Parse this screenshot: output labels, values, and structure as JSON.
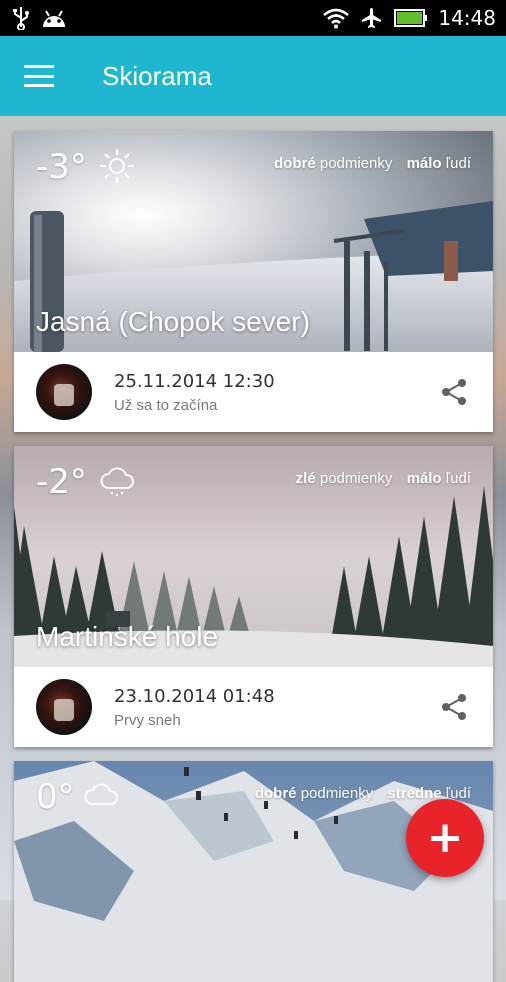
{
  "status_bar": {
    "time": "14:48",
    "icons": [
      "usb-icon",
      "android-icon",
      "wifi-icon",
      "airplane-icon",
      "battery-icon"
    ]
  },
  "app_bar": {
    "title": "Skiorama",
    "menu_icon": "menu-icon"
  },
  "cards": [
    {
      "temperature": "-3°",
      "weather_icon": "sun-icon",
      "condition_quality": "dobré",
      "condition_label": "podmienky",
      "crowd_level": "málo",
      "crowd_label": "ľudí",
      "place": "Jasná (Chopok sever)",
      "date": "25.11.2014 12:30",
      "caption": "Už sa to začína"
    },
    {
      "temperature": "-2°",
      "weather_icon": "snow-cloud-icon",
      "condition_quality": "zlé",
      "condition_label": "podmienky",
      "crowd_level": "málo",
      "crowd_label": "ľudí",
      "place": "Martinské hole",
      "date": "23.10.2014 01:48",
      "caption": "Prvy sneh"
    },
    {
      "temperature": "0°",
      "weather_icon": "cloud-icon",
      "condition_quality": "dobré",
      "condition_label": "podmienky",
      "crowd_level": "stredne",
      "crowd_label": "ľudí"
    }
  ],
  "fab": {
    "label": "+"
  },
  "colors": {
    "app_bar": "#1fb6cf",
    "fab": "#e8232a",
    "status_bar": "#000000"
  }
}
